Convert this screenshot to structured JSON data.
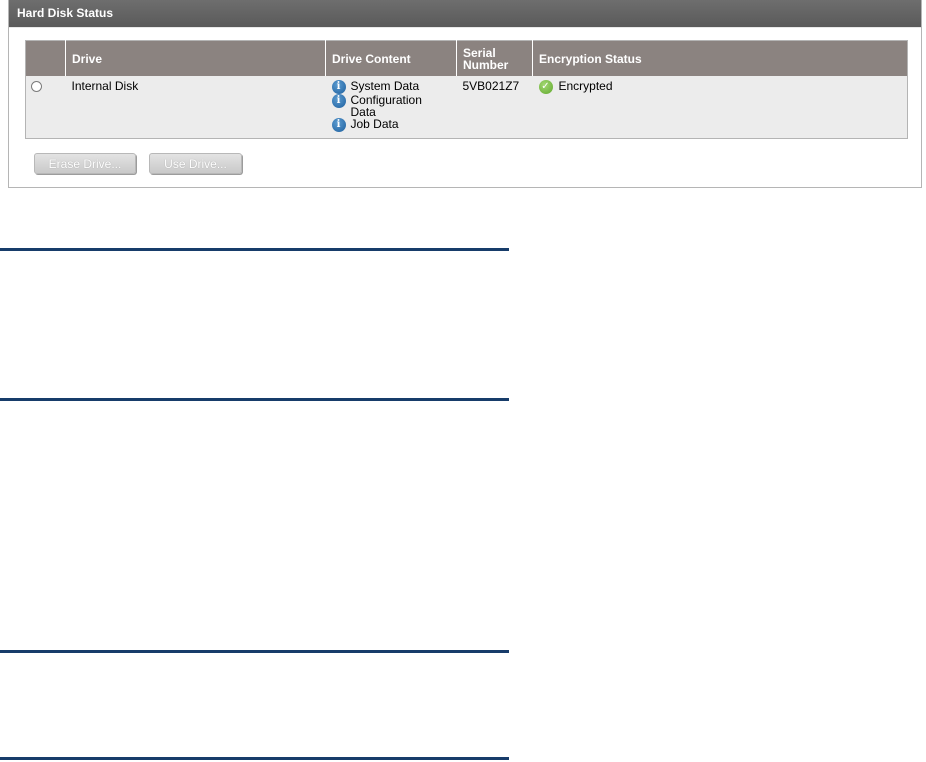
{
  "panel": {
    "title": "Hard Disk Status"
  },
  "table": {
    "headers": {
      "select": "",
      "drive": "Drive",
      "drive_content": "Drive Content",
      "serial_number_line1": "Serial",
      "serial_number_line2": "Number",
      "encryption_status": "Encryption Status"
    },
    "rows": [
      {
        "selected": false,
        "drive": "Internal Disk",
        "content": [
          {
            "icon": "info-icon",
            "line1": "System Data",
            "line2": ""
          },
          {
            "icon": "info-icon",
            "line1": "Configuration",
            "line2": "Data"
          },
          {
            "icon": "info-icon",
            "line1": "Job Data",
            "line2": ""
          }
        ],
        "serial": "5VB021Z7",
        "encryption_icon": "check-icon",
        "encryption_status": "Encrypted"
      }
    ]
  },
  "buttons": {
    "erase_label": "Erase Drive...",
    "use_label": "Use Drive..."
  },
  "colors": {
    "header_bar": "#5f5f5f",
    "table_header": "#8b8380",
    "row_bg": "#ececec",
    "rule": "#173c6a",
    "info_icon": "#2a6fae",
    "check_icon": "#6cb33a"
  }
}
